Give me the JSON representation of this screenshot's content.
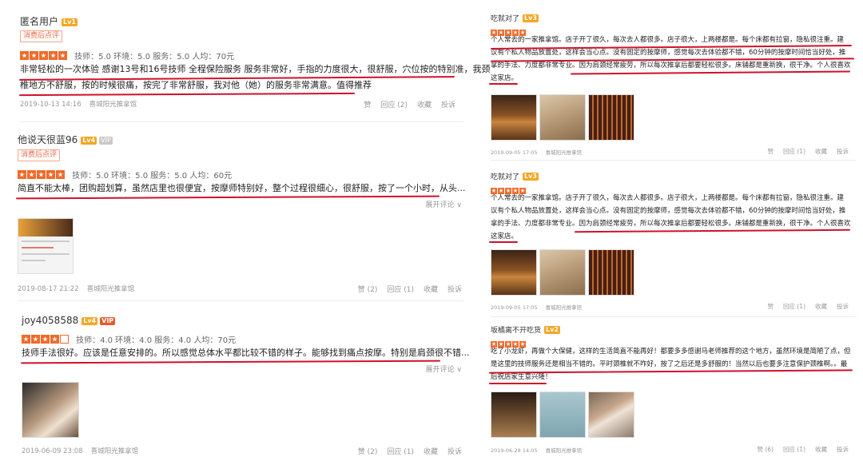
{
  "left": {
    "reviews": [
      {
        "user": "匿名用户",
        "level": "Lv1",
        "tag": "消费后点评",
        "scores": "技师：5.0  环境：5.0  服务：5.0  人均：70元",
        "line1": "非常轻松的一次体验 感谢13号和16号技师 全程保险服务 服务非常好，手指的力度很大，很舒服，穴位按的特别准，我颈",
        "line2": "椎地方不舒服，按的时候很痛，按完了非常舒服，我对他（她）的服务非常满意。值得推荐",
        "date": "2019-10-13 14:16",
        "shop": "喜城阳光推拿馆",
        "actions": [
          "赞",
          "回应 (2)",
          "收藏",
          "投诉"
        ]
      },
      {
        "user": "他说天很蓝96",
        "level": "Lv4",
        "vip": "VIP",
        "tag": "消费后点评",
        "scores": "技师：5.0  环境：5.0  服务：5.0  人均：60元",
        "line1": "简直不能太棒，团购超划算，虽然店里也很便宜，按摩师特别好，整个过程很细心，很舒服，按了一个小时，从头...",
        "expand": "展开评论 ∨",
        "date": "2019-08-17 21:22",
        "shop": "喜城阳光推拿馆",
        "actions": [
          "赞 (2)",
          "回应 (1)",
          "收藏",
          "投诉"
        ]
      },
      {
        "user": "joy4058588",
        "level": "Lv4",
        "vip": "VIP",
        "scores": "技师：4.0  环境：4.0  服务：4.0  人均：70元",
        "line1": "技师手法很好。应该是任意安排的。所以感觉总体水平都比较不错的样子。能够找到痛点按摩。特别是肩颈很不错...",
        "expand": "展开评论 ∨",
        "date": "2019-06-09 23:08",
        "shop": "喜城阳光推拿馆",
        "actions": [
          "赞 (2)",
          "回应 (1)",
          "收藏",
          "投诉"
        ]
      }
    ]
  },
  "right": {
    "reviews": [
      {
        "user": "吃就对了",
        "level": "Lv3",
        "lines": [
          "个人常去的一家推拿馆。店子开了很久，每次去人都很多。店子很大，上两楼都是。每个床都有拉窗，隐私很注重。建",
          "议有个私人物品放置处，这样会当心点。没有固定的按摩师，感觉每次去体验都不错，60分钟的按摩时间恰当好处，推",
          "拿的手法、力度都非常专业。因为肩颈经常疲劳，所以每次推拿后都要轻松很多。床铺都是重新换，很干净。个人很喜欢",
          "这家店。"
        ],
        "date": "2019-09-05 17:05",
        "shop": "喜城阳光推拿馆",
        "actions": [
          "赞",
          "回应 (1)",
          "收藏",
          "投诉"
        ]
      },
      {
        "user": "吃就对了",
        "level": "Lv3",
        "lines": [
          "个人常去的一家推拿馆。店子开了很久，每次去人都很多。店子很大，上两楼都是。每个床都有拉窗，隐私很注重。建",
          "议有个私人物品放置处，这样会当心点。没有固定的按摩师，感觉每次去体验都不错，60分钟的按摩时间恰当好处，推",
          "拿的手法、力度都非常专业。因为肩颈经常疲劳，所以每次推拿后都要轻松很多。床铺都是重新换，很干净。个人很喜欢",
          "这家店。"
        ],
        "date": "2019-09-05 17:05",
        "shop": "喜城阳光推拿馆",
        "actions": [
          "赞",
          "回应 (1)",
          "收藏",
          "投诉"
        ]
      },
      {
        "user": "坂橘离不开吃货",
        "level": "Lv2",
        "lines": [
          "吃了小龙虾，再做个大保健，这样的生活简直不能再好！都要多多感谢马老师推荐的这个地方，虽然环境是简陋了点，但",
          "是这里的技师服务还是相当不错的。平时颈椎就不咋好，按了之后还是多舒服的！当然以后也要多注意保护颈椎啊。。最",
          "后祝店家生意兴隆！"
        ],
        "date": "2019-06-28 14:05",
        "shop": "喜城阳光推拿馆",
        "actions": [
          "赞 (6)",
          "回应 (1)",
          "收藏",
          "投诉"
        ]
      }
    ]
  }
}
